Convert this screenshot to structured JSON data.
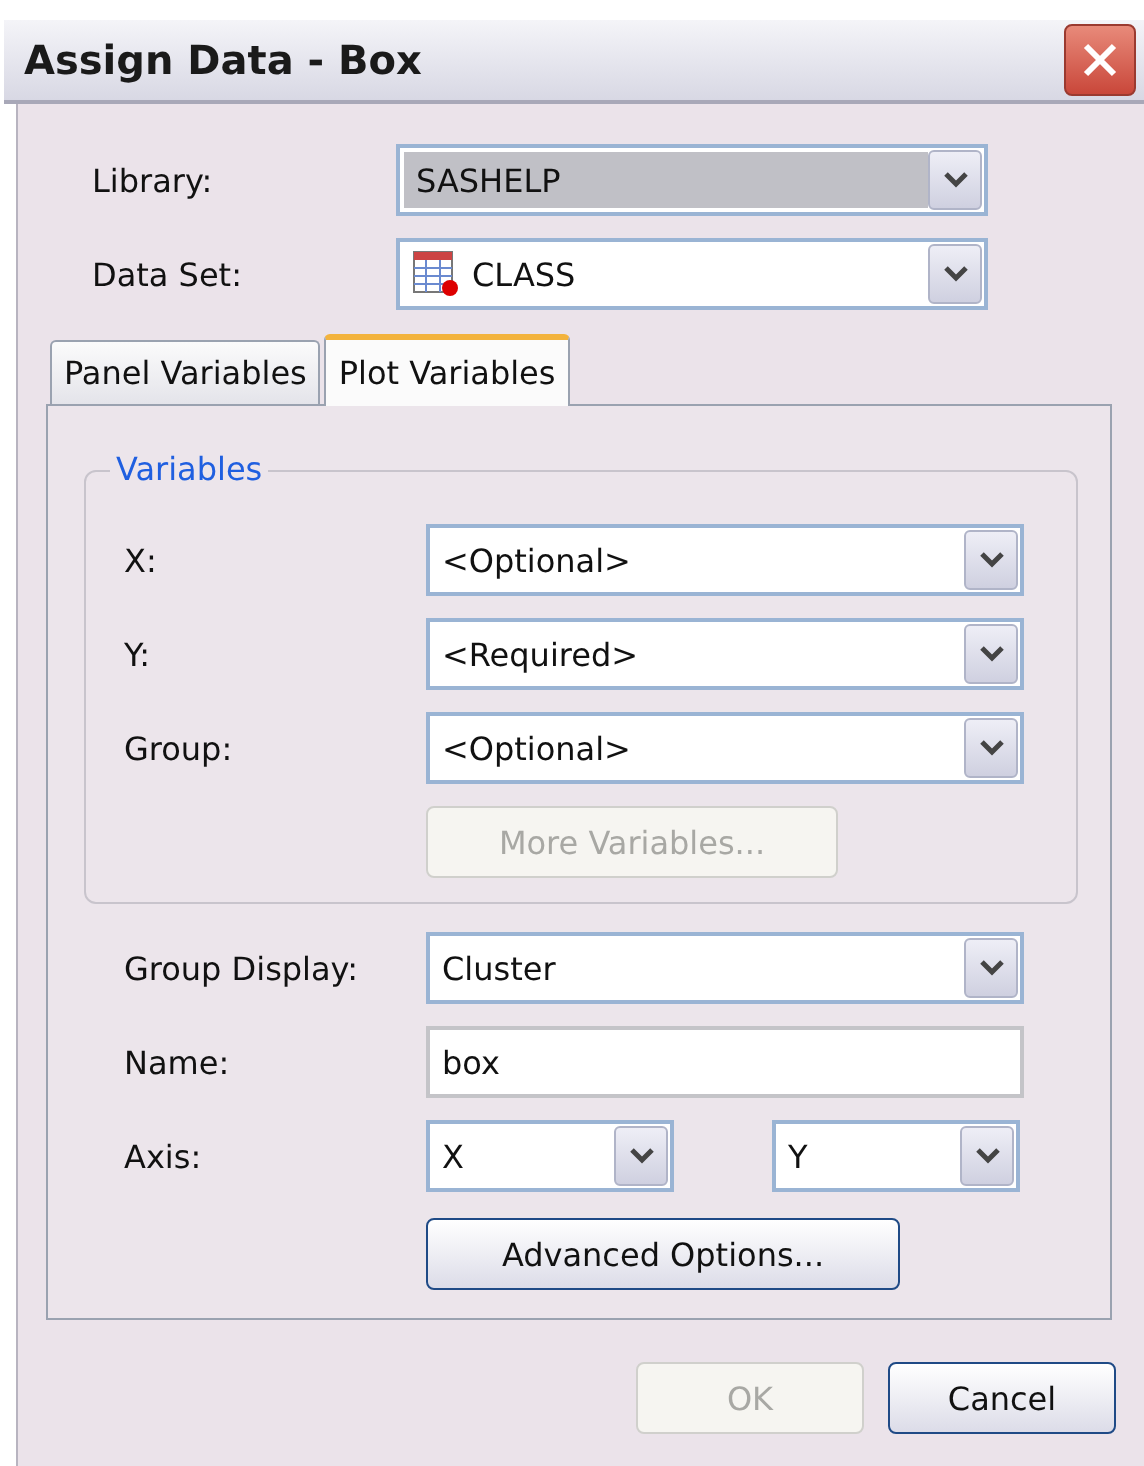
{
  "window": {
    "title": "Assign Data - Box"
  },
  "fields": [
    {
      "kind": "library",
      "label": "Library:",
      "value": "SASHELP",
      "disabled": true
    },
    {
      "kind": "dataset",
      "label": "Data Set:",
      "value": "CLASS",
      "disabled": false
    }
  ],
  "tabs": [
    {
      "label": "Panel Variables",
      "selected": false
    },
    {
      "label": "Plot Variables",
      "selected": true
    }
  ],
  "variables_group": {
    "title": "Variables",
    "rows": [
      {
        "label": "X:",
        "value": "<Optional>"
      },
      {
        "label": "Y:",
        "value": "<Required>"
      },
      {
        "label": "Group:",
        "value": "<Optional>"
      }
    ],
    "more_button": {
      "label": "More Variables...",
      "disabled": true
    }
  },
  "group_display": {
    "label": "Group Display:",
    "value": "Cluster"
  },
  "name": {
    "label": "Name:",
    "value": "box"
  },
  "axis": {
    "label": "Axis:",
    "x_value": "X",
    "y_value": "Y"
  },
  "advanced_button": {
    "label": "Advanced Options..."
  },
  "buttons": [
    {
      "label": "OK",
      "disabled": true
    },
    {
      "label": "Cancel",
      "disabled": false
    }
  ]
}
